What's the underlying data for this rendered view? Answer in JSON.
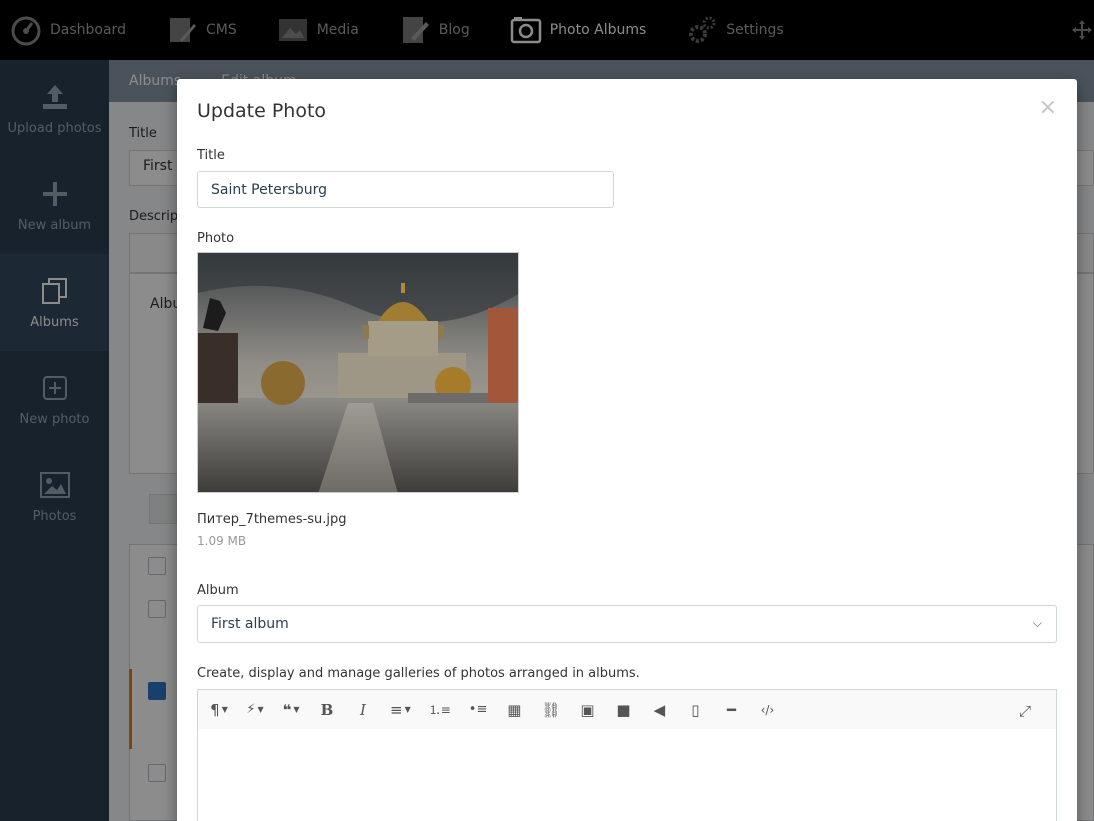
{
  "topnav": {
    "items": [
      {
        "label": "Dashboard",
        "icon": "dashboard-icon"
      },
      {
        "label": "CMS",
        "icon": "cms-icon"
      },
      {
        "label": "Media",
        "icon": "media-icon"
      },
      {
        "label": "Blog",
        "icon": "blog-icon"
      },
      {
        "label": "Photo Albums",
        "icon": "camera-icon",
        "active": true
      },
      {
        "label": "Settings",
        "icon": "gears-icon"
      }
    ]
  },
  "sidebar": {
    "items": [
      {
        "label": "Upload photos",
        "icon": "upload-icon"
      },
      {
        "label": "New album",
        "icon": "plus-icon"
      },
      {
        "label": "Albums",
        "icon": "albums-icon",
        "active": true
      },
      {
        "label": "New photo",
        "icon": "add-box-icon"
      },
      {
        "label": "Photos",
        "icon": "image-icon"
      }
    ]
  },
  "bg": {
    "breadcrumb_albums": "Albums",
    "breadcrumb_edit": "Edit album",
    "title_label": "Title",
    "title_value": "First",
    "description_label": "Descrip",
    "album_text": "Albu"
  },
  "modal": {
    "title": "Update Photo",
    "close": "×",
    "title_label": "Title",
    "title_value": "Saint Petersburg",
    "photo_label": "Photo",
    "file_name": "Питер_7themes-su.jpg",
    "file_size": "1.09 MB",
    "album_label": "Album",
    "album_value": "First album",
    "description_help": "Create, display and manage galleries of photos arranged in albums."
  },
  "colors": {
    "topnav_bg": "#000000",
    "sidebar_bg": "#2b3e50",
    "accent_orange": "#e67e22",
    "checkbox_blue": "#2f76c2"
  }
}
